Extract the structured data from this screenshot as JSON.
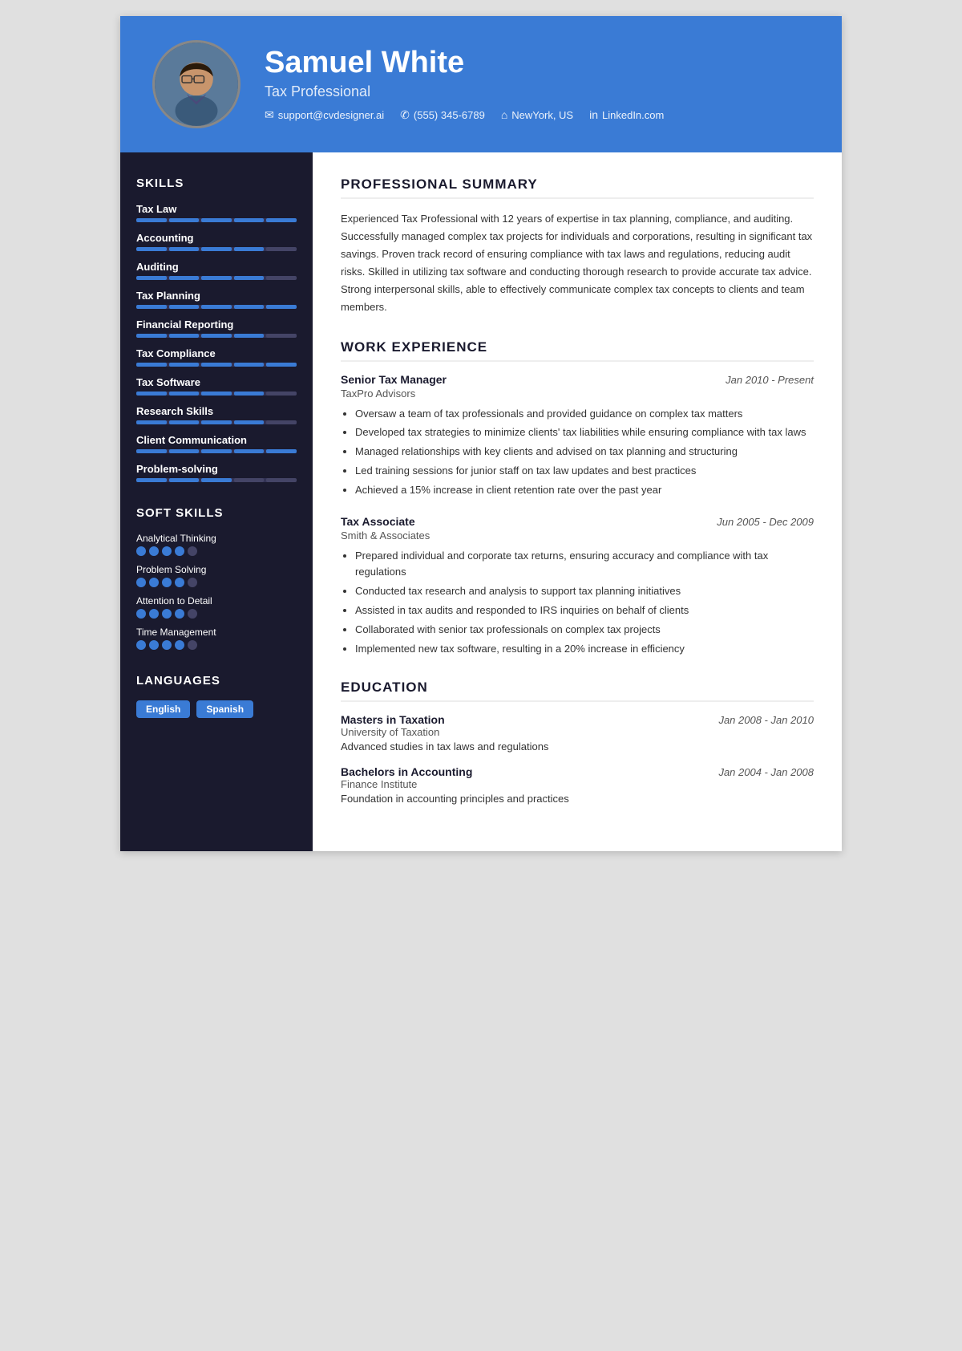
{
  "header": {
    "name": "Samuel White",
    "title": "Tax Professional",
    "contacts": [
      {
        "icon": "✉",
        "text": "support@cvdesigner.ai",
        "type": "email"
      },
      {
        "icon": "✆",
        "text": "(555) 345-6789",
        "type": "phone"
      },
      {
        "icon": "⌂",
        "text": "NewYork, US",
        "type": "location"
      },
      {
        "icon": "in",
        "text": "LinkedIn.com",
        "type": "linkedin"
      }
    ]
  },
  "sidebar": {
    "skills_title": "SKILLS",
    "skills": [
      {
        "name": "Tax Law",
        "filled": 5,
        "total": 5
      },
      {
        "name": "Accounting",
        "filled": 4,
        "total": 5
      },
      {
        "name": "Auditing",
        "filled": 4,
        "total": 5
      },
      {
        "name": "Tax Planning",
        "filled": 5,
        "total": 5
      },
      {
        "name": "Financial Reporting",
        "filled": 4,
        "total": 5
      },
      {
        "name": "Tax Compliance",
        "filled": 5,
        "total": 5
      },
      {
        "name": "Tax Software",
        "filled": 4,
        "total": 5
      },
      {
        "name": "Research Skills",
        "filled": 4,
        "total": 5
      },
      {
        "name": "Client Communication",
        "filled": 5,
        "total": 5
      },
      {
        "name": "Problem-solving",
        "filled": 3,
        "total": 5
      }
    ],
    "soft_skills_title": "SOFT SKILLS",
    "soft_skills": [
      {
        "name": "Analytical Thinking",
        "filled": 4,
        "total": 5
      },
      {
        "name": "Problem Solving",
        "filled": 4,
        "total": 5
      },
      {
        "name": "Attention to Detail",
        "filled": 4,
        "total": 5
      },
      {
        "name": "Time Management",
        "filled": 4,
        "total": 5
      }
    ],
    "languages_title": "LANGUAGES",
    "languages": [
      "English",
      "Spanish"
    ]
  },
  "main": {
    "summary_title": "PROFESSIONAL SUMMARY",
    "summary_text": "Experienced Tax Professional with 12 years of expertise in tax planning, compliance, and auditing. Successfully managed complex tax projects for individuals and corporations, resulting in significant tax savings. Proven track record of ensuring compliance with tax laws and regulations, reducing audit risks. Skilled in utilizing tax software and conducting thorough research to provide accurate tax advice. Strong interpersonal skills, able to effectively communicate complex tax concepts to clients and team members.",
    "experience_title": "WORK EXPERIENCE",
    "jobs": [
      {
        "title": "Senior Tax Manager",
        "dates": "Jan 2010 - Present",
        "company": "TaxPro Advisors",
        "bullets": [
          "Oversaw a team of tax professionals and provided guidance on complex tax matters",
          "Developed tax strategies to minimize clients' tax liabilities while ensuring compliance with tax laws",
          "Managed relationships with key clients and advised on tax planning and structuring",
          "Led training sessions for junior staff on tax law updates and best practices",
          "Achieved a 15% increase in client retention rate over the past year"
        ]
      },
      {
        "title": "Tax Associate",
        "dates": "Jun 2005 - Dec 2009",
        "company": "Smith & Associates",
        "bullets": [
          "Prepared individual and corporate tax returns, ensuring accuracy and compliance with tax regulations",
          "Conducted tax research and analysis to support tax planning initiatives",
          "Assisted in tax audits and responded to IRS inquiries on behalf of clients",
          "Collaborated with senior tax professionals on complex tax projects",
          "Implemented new tax software, resulting in a 20% increase in efficiency"
        ]
      }
    ],
    "education_title": "EDUCATION",
    "education": [
      {
        "degree": "Masters in Taxation",
        "dates": "Jan 2008 - Jan 2010",
        "school": "University of Taxation",
        "description": "Advanced studies in tax laws and regulations"
      },
      {
        "degree": "Bachelors in Accounting",
        "dates": "Jan 2004 - Jan 2008",
        "school": "Finance Institute",
        "description": "Foundation in accounting principles and practices"
      }
    ]
  }
}
